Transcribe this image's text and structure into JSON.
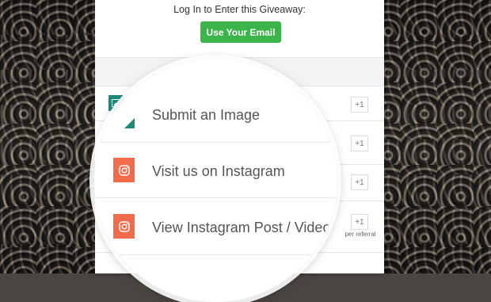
{
  "header": {
    "login_text": "Log In to Enter this Giveaway:",
    "email_button": "Use Your Email"
  },
  "entries": [
    {
      "label": "Submit an Image",
      "points": "+1",
      "icon": "image-icon",
      "color": "#1e8a79"
    },
    {
      "label": "Visit us on Instagram",
      "points": "+1",
      "icon": "instagram-icon",
      "color": "#f26b4a"
    },
    {
      "label": "View Instagram Post / Video",
      "points": "+1",
      "icon": "instagram-icon",
      "color": "#f26b4a"
    },
    {
      "points": "+1",
      "sublabel": "per referral"
    }
  ],
  "colors": {
    "accent_green": "#3bb54a",
    "instagram_orange": "#f26b4a",
    "image_teal": "#1e8a79"
  }
}
